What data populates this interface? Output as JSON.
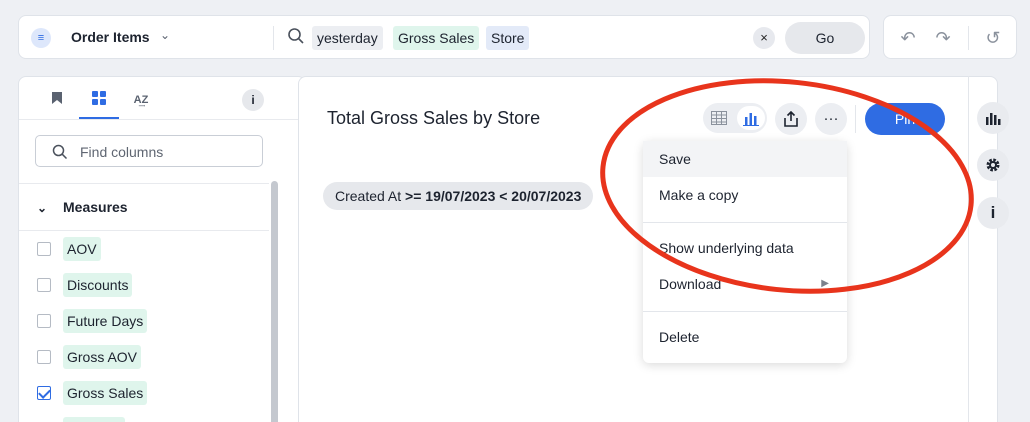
{
  "search": {
    "source_name": "Order Items",
    "tokens": [
      {
        "text": "yesterday",
        "kind": "neutral"
      },
      {
        "text": "Gross Sales",
        "kind": "measure"
      },
      {
        "text": "Store",
        "kind": "attr"
      }
    ],
    "clear_label": "×",
    "go_label": "Go"
  },
  "history": {
    "undo": "↶",
    "redo": "↷",
    "reset": "↺"
  },
  "left_panel": {
    "info_label": "i",
    "find_placeholder": "Find columns",
    "section_title": "Measures",
    "columns": [
      {
        "label": "AOV",
        "checked": false
      },
      {
        "label": "Discounts",
        "checked": false
      },
      {
        "label": "Future Days",
        "checked": false
      },
      {
        "label": "Gross AOV",
        "checked": false
      },
      {
        "label": "Gross Sales",
        "checked": true
      }
    ]
  },
  "viz": {
    "title": "Total Gross Sales by Store",
    "pin_label": "Pin",
    "more_label": "···",
    "filter": {
      "label": "Created At",
      "value": ">= 19/07/2023 < 20/07/2023"
    }
  },
  "menu": {
    "items": [
      "Save",
      "Make a copy",
      "Show underlying data",
      "Download",
      "Delete"
    ]
  },
  "colors": {
    "accent": "#2f6ce3",
    "annotation": "#e8341c",
    "measure_token": "#dff5ec",
    "attribute_token": "#e3eaf8"
  }
}
